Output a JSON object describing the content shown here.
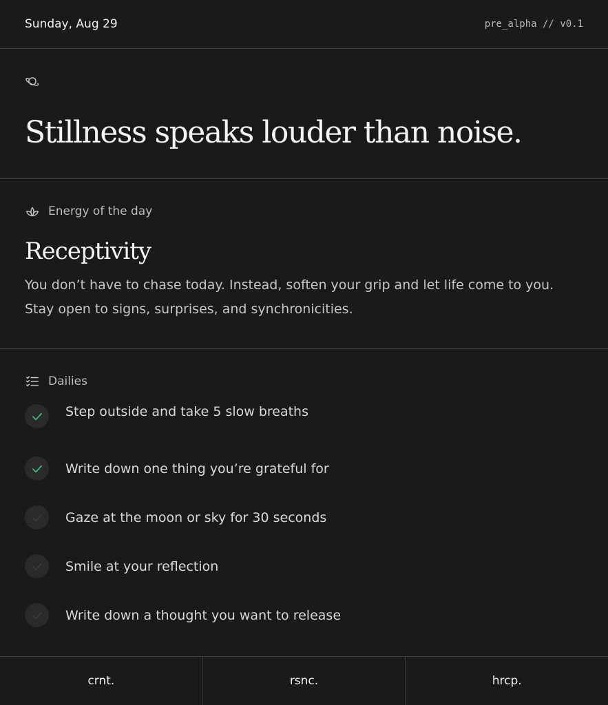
{
  "header": {
    "date": "Sunday, Aug 29",
    "version": "pre_alpha // v0.1"
  },
  "hero": {
    "icon": "planet-icon",
    "quote": "Stillness speaks louder than noise."
  },
  "energy": {
    "icon": "lotus-icon",
    "label": "Energy of the day",
    "title": "Receptivity",
    "description": "You don’t have to chase today. Instead, soften your grip and let life come to you. Stay open to signs, surprises, and synchronicities."
  },
  "dailies": {
    "icon": "checklist-icon",
    "label": "Dailies",
    "done_color": "#3dbb79",
    "pending_color": "#3a3a3a",
    "tasks": [
      {
        "text": "Step outside and take 5 slow breaths",
        "done": true
      },
      {
        "text": "Write down one thing you’re grateful for",
        "done": true
      },
      {
        "text": "Gaze at the moon or sky for 30 seconds",
        "done": false
      },
      {
        "text": "Smile at your reflection",
        "done": false
      },
      {
        "text": "Write down a thought you want to release",
        "done": false
      }
    ]
  },
  "tabs": [
    {
      "label": "crnt."
    },
    {
      "label": "rsnc."
    },
    {
      "label": "hrcp."
    }
  ]
}
